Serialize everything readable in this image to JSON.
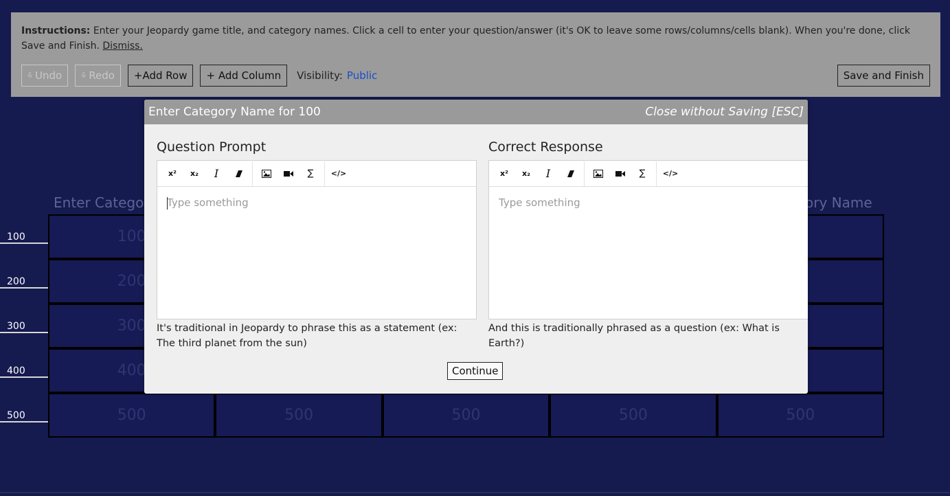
{
  "instructions": {
    "label": "Instructions:",
    "text": " Enter your Jeopardy game title, and category names. Click a cell to enter your question/answer (it's OK to leave some rows/columns/cells blank). When you're done, click Save and Finish.",
    "dismiss": "Dismiss."
  },
  "toolbar": {
    "undo": "Undo",
    "redo": "Redo",
    "add_row": "+Add Row",
    "add_column": "+ Add Column",
    "visibility_label": "Visibility:",
    "visibility_value": "Public",
    "save_finish": "Save and Finish"
  },
  "board": {
    "categories": [
      "Enter Catego",
      "",
      "",
      "",
      "ory Name"
    ],
    "row_values": [
      "100",
      "200",
      "300",
      "400",
      "500"
    ],
    "cells": [
      [
        "100",
        "",
        "",
        "",
        "0"
      ],
      [
        "200",
        "",
        "",
        "",
        "0"
      ],
      [
        "300",
        "",
        "",
        "",
        "0"
      ],
      [
        "400",
        "",
        "",
        "",
        "0"
      ],
      [
        "500",
        "500",
        "500",
        "500",
        "500"
      ]
    ]
  },
  "modal": {
    "title": "Enter Category Name for 100",
    "close": "Close without Saving [ESC]",
    "question": {
      "title": "Question Prompt",
      "placeholder": "Type something",
      "hint": "It's traditional in Jeopardy to phrase this as a statement (ex: The third planet from the sun)"
    },
    "response": {
      "title": "Correct Response",
      "placeholder": "Type something",
      "hint": "And this is traditionally phrased as a question (ex: What is Earth?)"
    },
    "continue": "Continue"
  },
  "editor_tools": {
    "superscript": "x²",
    "subscript": "x₂",
    "italic": "I",
    "eraser": "⌫",
    "image": "▣",
    "video": "■",
    "sigma": "∑",
    "code": "</>"
  }
}
